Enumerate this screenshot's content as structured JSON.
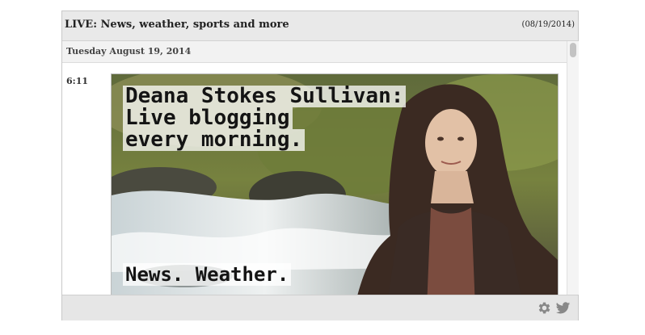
{
  "header": {
    "title": "LIVE: News, weather, sports and more",
    "date": "(08/19/2014)"
  },
  "feed": {
    "day_label": "Tuesday August 19, 2014",
    "entry": {
      "time": "6:11",
      "image_caption_lines": [
        "Deana Stokes Sullivan:",
        "Live blogging",
        "every morning."
      ],
      "image_caption_bottom": "News. Weather."
    }
  },
  "footer": {
    "icons": [
      "gear-icon",
      "twitter-icon"
    ]
  },
  "colors": {
    "header_bg": "#e9e9e9",
    "footer_bg": "#e6e6e6",
    "icon": "#888888"
  }
}
